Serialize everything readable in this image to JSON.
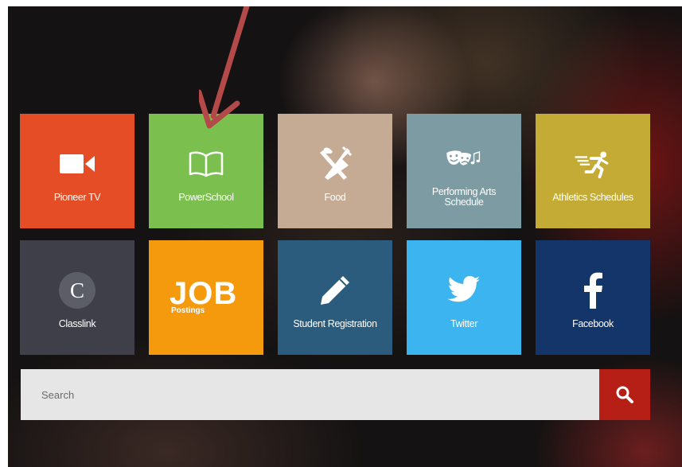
{
  "tiles": [
    {
      "label": "Pioneer TV",
      "icon": "video-camera-icon",
      "color": "#e44d26"
    },
    {
      "label": "PowerSchool",
      "icon": "open-book-icon",
      "color": "#7bc04e"
    },
    {
      "label": "Food",
      "icon": "fork-knife-icon",
      "color": "#c5ab94"
    },
    {
      "label": "Performing Arts Schedule",
      "icon": "theater-masks-icon",
      "color": "#7c9ba3"
    },
    {
      "label": "Athletics Schedules",
      "icon": "runner-icon",
      "color": "#c3ab36"
    },
    {
      "label": "Classlink",
      "icon": "classlink-c-icon",
      "color": "#3e3f49"
    },
    {
      "label": "Postings",
      "icon": "job-postings-logo",
      "logo_text": "JOB",
      "color": "#f59a0c"
    },
    {
      "label": "Student Registration",
      "icon": "pencil-icon",
      "color": "#2b5c7d"
    },
    {
      "label": "Twitter",
      "icon": "twitter-bird-icon",
      "color": "#3cb4ef"
    },
    {
      "label": "Facebook",
      "icon": "facebook-f-icon",
      "color": "#13356a"
    }
  ],
  "search": {
    "placeholder": "Search",
    "button_icon": "search-icon",
    "button_color": "#b51f16"
  },
  "annotation": {
    "icon": "red-arrow-annotation",
    "color": "#b34a49"
  }
}
